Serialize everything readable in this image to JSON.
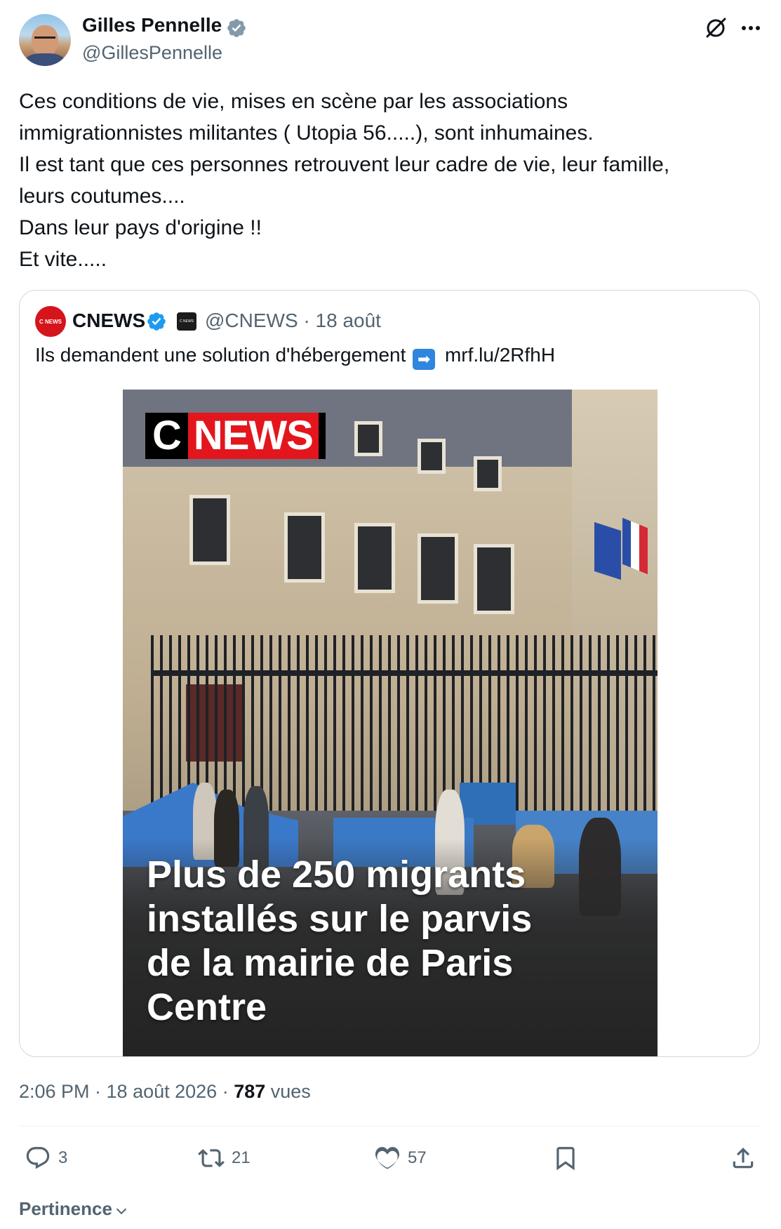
{
  "author": {
    "display_name": "Gilles Pennelle",
    "handle": "@GillesPennelle",
    "avatar": "profile-photo-icon"
  },
  "tweet": {
    "lines": [
      "Ces conditions de vie, mises en scène par les associations",
      "immigrationnistes militantes ( Utopia 56.....), sont inhumaines.",
      "Il est tant que ces personnes retrouvent leur cadre de vie, leur famille,",
      "leurs coutumes....",
      "Dans leur pays d'origine !!",
      "Et vite....."
    ]
  },
  "quote": {
    "display_name": "CNEWS",
    "handle": "@CNEWS",
    "date": "· 18 août",
    "text": "Ils demandent une solution d'hébergement",
    "arrow": "➡",
    "link": "mrf.lu/2RfhH",
    "avatar_label": "C NEWS",
    "badge_label": "C NEWS",
    "media": {
      "logo_c": "C",
      "logo_news": "NEWS",
      "overlay_lines": [
        "Plus de 250 migrants",
        "installés sur le parvis",
        "de la mairie de Paris",
        "Centre"
      ]
    }
  },
  "meta": {
    "time_date": "2:06 PM · 18 août 2026 · ",
    "views_count": "787",
    "views_label": " vues"
  },
  "actions": {
    "replies": "3",
    "reposts": "21",
    "likes": "57"
  },
  "sort_label": "Pertinence",
  "colors": {
    "verified": "#1d9bf0",
    "secondary_text": "#536471",
    "brand_red": "#e3161d"
  }
}
